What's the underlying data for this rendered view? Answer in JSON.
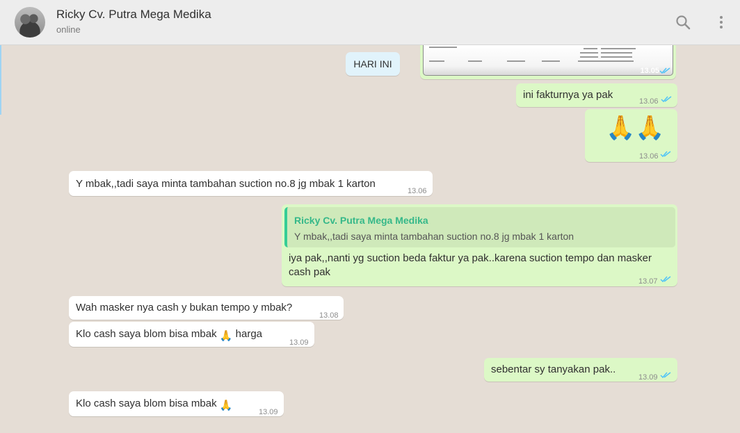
{
  "header": {
    "contact_name": "Ricky Cv. Putra Mega Medika",
    "status": "online",
    "icons": [
      "search-icon",
      "menu-dots-icon"
    ]
  },
  "chat": {
    "date_chip": "HARI INI",
    "image_message": {
      "time": "13.05",
      "ticks": "double-blue"
    },
    "messages": [
      {
        "dir": "out",
        "text": "ini fakturnya ya pak",
        "time": "13.06"
      },
      {
        "dir": "out",
        "text": "🙏🙏",
        "time": "13.06"
      },
      {
        "dir": "in",
        "text": "Y mbak,,tadi saya minta tambahan suction no.8 jg mbak 1 karton",
        "time": "13.06"
      },
      {
        "dir": "out",
        "quote_name": "Ricky Cv. Putra Mega Medika",
        "quote_text": "Y mbak,,tadi saya minta tambahan suction no.8 jg mbak 1 karton",
        "text": "iya pak,,nanti yg suction beda faktur ya pak..karena suction tempo dan masker cash pak",
        "time": "13.07"
      },
      {
        "dir": "in",
        "text": "Wah masker nya cash y bukan tempo y mbak?",
        "time": "13.08"
      },
      {
        "dir": "in",
        "text_before": "Klo cash saya blom bisa mbak",
        "text_after": "harga",
        "time": "13.09"
      },
      {
        "dir": "out",
        "text": "sebentar sy tanyakan pak..",
        "time": "13.09"
      },
      {
        "dir": "in",
        "text_before": "Klo cash saya blom bisa mbak",
        "text_after": "",
        "time": "13.09"
      }
    ]
  },
  "colors": {
    "incoming_bubble": "#ffffff",
    "outgoing_bubble": "#dcf8c6",
    "chat_background": "#e5ddd5",
    "read_ticks": "#4fc3f7",
    "quote_accent": "#35cd96"
  }
}
